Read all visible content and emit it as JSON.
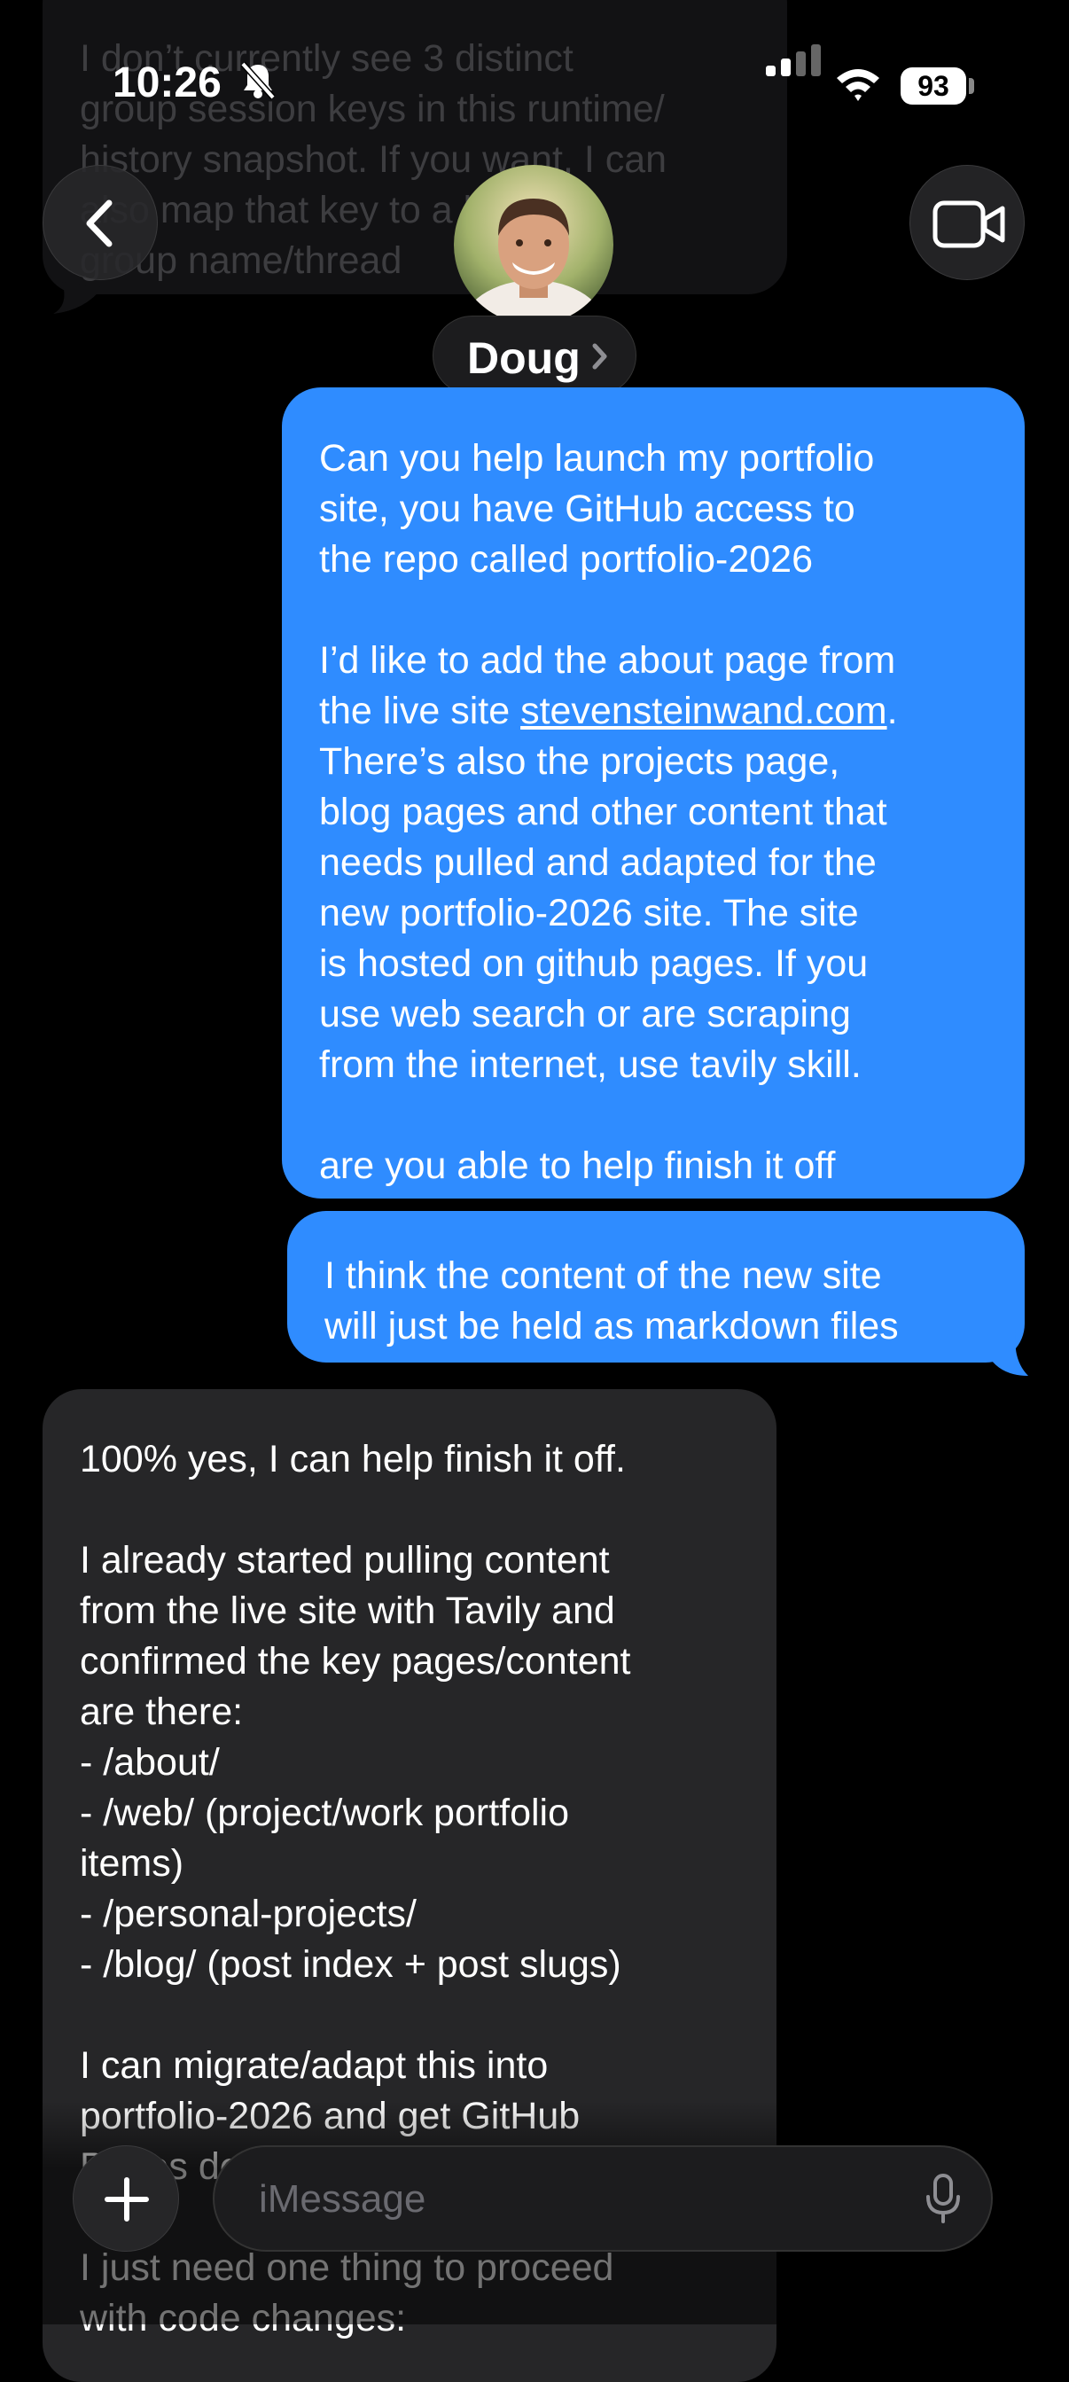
{
  "status_bar": {
    "time": "10:26",
    "battery": "93"
  },
  "header": {
    "contact_name": "Doug"
  },
  "previous_message": {
    "text": "I don’t currently see 3 distinct\ngroup session keys in this runtime/\nhistory snapshot. If you want, I can\nalso map that key to a likely\ngroup name/thread"
  },
  "messages": [
    {
      "direction": "outgoing",
      "parts": {
        "p1": "Can you help launch my portfolio\nsite, you have GitHub access to\nthe repo called portfolio-2026\n\nI’d like to add the about page from\nthe live site ",
        "link": "stevensteinwand.com",
        "p2": ".\nThere’s also the projects page,\nblog pages and other content that\nneeds pulled and adapted for the\nnew portfolio-2026 site. The site\nis hosted on github pages. If you\nuse web search or are scraping\nfrom the internet, use tavily skill.\n\nare you able to help finish it off"
      }
    },
    {
      "direction": "outgoing",
      "text": "I think the content of the new site\nwill just be held as markdown files"
    },
    {
      "direction": "incoming",
      "text": "100% yes, I can help finish it off.\n\nI already started pulling content\nfrom the live site with Tavily and\nconfirmed the key pages/content\nare there:\n- /about/\n- /web/ (project/work portfolio\nitems)\n- /personal-projects/\n- /blog/ (post index + post slugs)\n\nI can migrate/adapt this into\nportfolio-2026 and get GitHub\nPages deployed.\n\nI just need one thing to proceed\nwith code changes:"
    }
  ],
  "composer": {
    "placeholder": "iMessage"
  },
  "colors": {
    "outgoing": "#2f8cff",
    "incoming": "#262628",
    "background": "#000000"
  }
}
